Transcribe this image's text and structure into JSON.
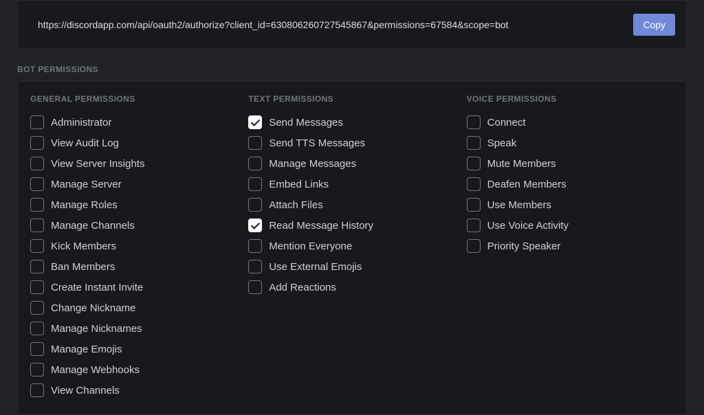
{
  "oauth_url": "https://discordapp.com/api/oauth2/authorize?client_id=630806260727545867&permissions=67584&scope=bot",
  "copy_label": "Copy",
  "section_title": "Bot Permissions",
  "columns": [
    {
      "title": "General Permissions",
      "perms": [
        {
          "label": "Administrator",
          "checked": false
        },
        {
          "label": "View Audit Log",
          "checked": false
        },
        {
          "label": "View Server Insights",
          "checked": false
        },
        {
          "label": "Manage Server",
          "checked": false
        },
        {
          "label": "Manage Roles",
          "checked": false
        },
        {
          "label": "Manage Channels",
          "checked": false
        },
        {
          "label": "Kick Members",
          "checked": false
        },
        {
          "label": "Ban Members",
          "checked": false
        },
        {
          "label": "Create Instant Invite",
          "checked": false
        },
        {
          "label": "Change Nickname",
          "checked": false
        },
        {
          "label": "Manage Nicknames",
          "checked": false
        },
        {
          "label": "Manage Emojis",
          "checked": false
        },
        {
          "label": "Manage Webhooks",
          "checked": false
        },
        {
          "label": "View Channels",
          "checked": false
        }
      ]
    },
    {
      "title": "Text Permissions",
      "perms": [
        {
          "label": "Send Messages",
          "checked": true
        },
        {
          "label": "Send TTS Messages",
          "checked": false
        },
        {
          "label": "Manage Messages",
          "checked": false
        },
        {
          "label": "Embed Links",
          "checked": false
        },
        {
          "label": "Attach Files",
          "checked": false
        },
        {
          "label": "Read Message History",
          "checked": true
        },
        {
          "label": "Mention Everyone",
          "checked": false
        },
        {
          "label": "Use External Emojis",
          "checked": false
        },
        {
          "label": "Add Reactions",
          "checked": false
        }
      ]
    },
    {
      "title": "Voice Permissions",
      "perms": [
        {
          "label": "Connect",
          "checked": false
        },
        {
          "label": "Speak",
          "checked": false
        },
        {
          "label": "Mute Members",
          "checked": false
        },
        {
          "label": "Deafen Members",
          "checked": false
        },
        {
          "label": "Use Members",
          "checked": false
        },
        {
          "label": "Use Voice Activity",
          "checked": false
        },
        {
          "label": "Priority Speaker",
          "checked": false
        }
      ]
    }
  ]
}
